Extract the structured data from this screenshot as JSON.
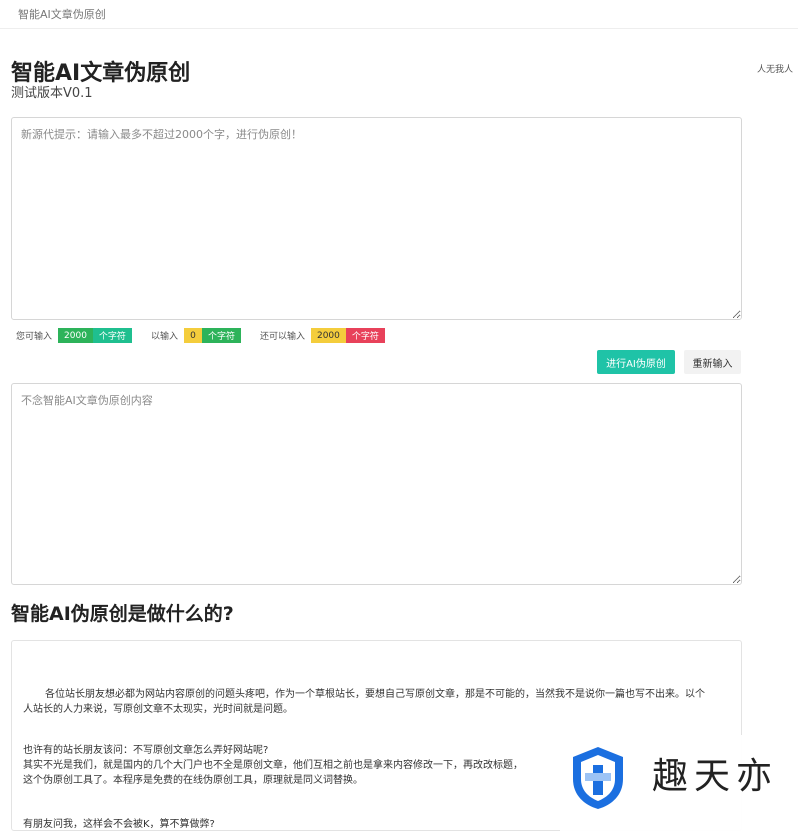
{
  "topbar": {
    "brand": "智能AI文章伪原创"
  },
  "side_note": "人无我人",
  "header": {
    "title": "智能AI文章伪原创",
    "version": "测试版本V0.1"
  },
  "input": {
    "placeholder": "新源代提示：请输入最多不超过2000个字，进行伪原创！",
    "value": ""
  },
  "counters": {
    "available_label": "您可输入",
    "available_value": "2000",
    "available_unit": "个字符",
    "entered_label": "以输入",
    "entered_value": "0",
    "entered_unit": "个字符",
    "remaining_label": "还可以输入",
    "remaining_value": "2000",
    "remaining_unit": "个字符"
  },
  "actions": {
    "rewrite_label": "进行AI伪原创",
    "reset_label": "重新输入"
  },
  "output": {
    "placeholder": "不念智能AI文章伪原创内容",
    "value": ""
  },
  "section": {
    "title": "智能AI伪原创是做什么的?"
  },
  "article": {
    "p1_lead": "各位站长朋友想必都为网站内容原创的问题头疼吧，作为一个草根站长，要想自己写原创文章，那是不可能的，当然我不是说你一篇也写不出来。以个",
    "p1_cont": "人站长的人力来说，写原创文章不太现实，光时间就是问题。",
    "p2_l1": "也许有的站长朋友该问：不写原创文章怎么弄好网站呢?",
    "p2_l2": "其实不光是我们，就是国内的几个大门户也不全是原创文章，他们互相之前也是拿来内容修改一下，再改改标题，",
    "p2_l3": "这个伪原创工具了。本程序是免费的在线伪原创工具，原理就是同义词替换。",
    "p3": "有朋友问我，这样会不会被K，算不算做弊?"
  },
  "watermark": {
    "text": "趣天亦",
    "logo_icon": "shield-logo-icon",
    "colors": {
      "blue": "#1b6fe0",
      "light_blue": "#9cc3f5"
    }
  },
  "colors": {
    "primary_button": "#1fc3a7",
    "badge_green": "#2db35a",
    "badge_teal": "#1fbf8f",
    "badge_yellow": "#f4cd3c",
    "badge_red": "#e8415a"
  }
}
